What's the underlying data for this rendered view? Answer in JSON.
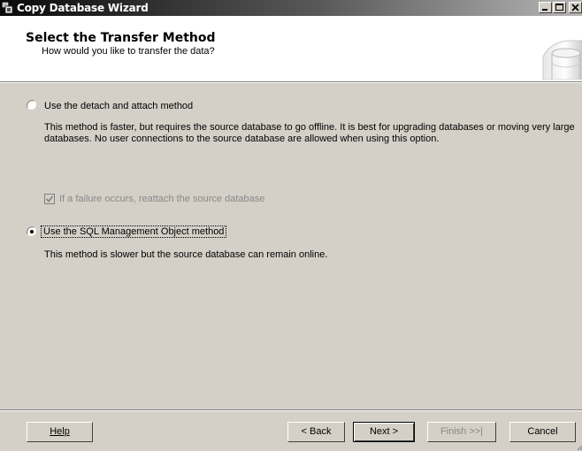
{
  "window": {
    "title": "Copy Database Wizard"
  },
  "header": {
    "title": "Select the Transfer Method",
    "subtitle": "How would you like to transfer the data?"
  },
  "options": {
    "detach": {
      "label": "Use the detach and attach method",
      "selected": false,
      "description": "This method is faster, but requires the source database to go offline. It is best for upgrading databases or moving very large databases. No user connections to the source database are allowed when using this option."
    },
    "reattach": {
      "label": "If a failure occurs, reattach the source database",
      "checked": true,
      "enabled": false
    },
    "smo": {
      "label": "Use the SQL Management Object method",
      "selected": true,
      "description": "This method is slower but the source database can remain online."
    }
  },
  "buttons": {
    "help": "Help",
    "back": "< Back",
    "next": "Next >",
    "finish": "Finish >>|",
    "cancel": "Cancel"
  },
  "icons": {
    "app": "database-wizard-icon",
    "minimize": "minimize-icon",
    "maximize": "maximize-icon",
    "close": "close-icon",
    "header_graphic": "database-cylinder-icon",
    "grip": "resize-grip-icon"
  }
}
